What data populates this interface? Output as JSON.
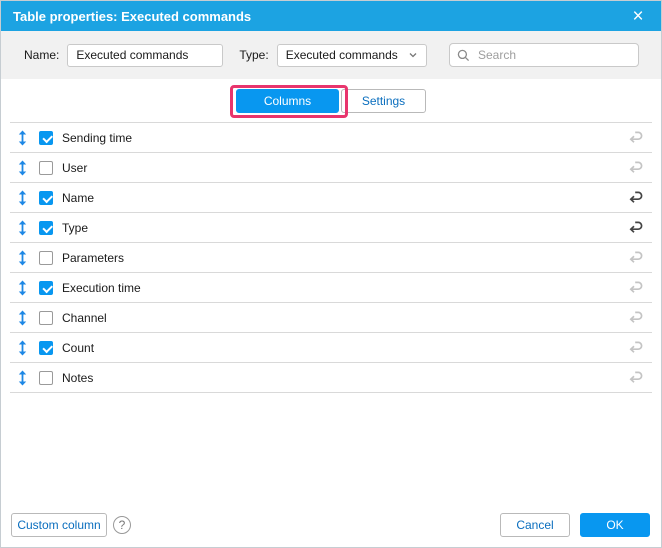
{
  "dialog": {
    "title": "Table properties: Executed commands"
  },
  "icons": {
    "close": "×",
    "help": "?"
  },
  "toolbar": {
    "name_label": "Name:",
    "name_value": "Executed commands",
    "type_label": "Type:",
    "type_value": "Executed commands",
    "search_placeholder": "Search"
  },
  "tabs": [
    {
      "label": "Columns",
      "active": true,
      "annotated": true
    },
    {
      "label": "Settings",
      "active": false
    }
  ],
  "columns": [
    {
      "label": "Sending time",
      "checked": true,
      "reset_enabled": false
    },
    {
      "label": "User",
      "checked": false,
      "reset_enabled": false
    },
    {
      "label": "Name",
      "checked": true,
      "reset_enabled": true
    },
    {
      "label": "Type",
      "checked": true,
      "reset_enabled": true
    },
    {
      "label": "Parameters",
      "checked": false,
      "reset_enabled": false
    },
    {
      "label": "Execution time",
      "checked": true,
      "reset_enabled": false
    },
    {
      "label": "Channel",
      "checked": false,
      "reset_enabled": false
    },
    {
      "label": "Count",
      "checked": true,
      "reset_enabled": false
    },
    {
      "label": "Notes",
      "checked": false,
      "reset_enabled": false
    }
  ],
  "footer": {
    "custom_column_label": "Custom column",
    "cancel_label": "Cancel",
    "ok_label": "OK"
  },
  "colors": {
    "header_blue": "#1CA3E2",
    "control_blue": "#0897F0",
    "link_blue": "#0A6EBE",
    "annotation_pink": "#E8356D",
    "drag_blue": "#1E88E5"
  }
}
